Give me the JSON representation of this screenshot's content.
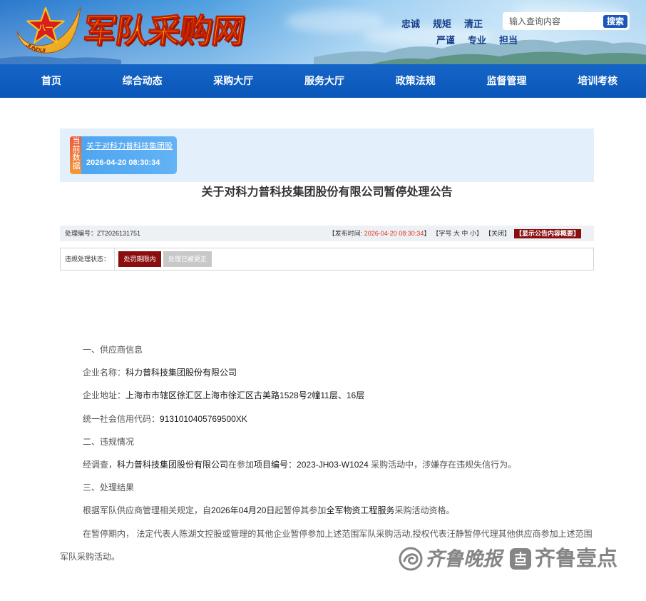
{
  "header": {
    "site_title": "军队采购网",
    "logo": {
      "emblem_mark": "八一",
      "swoosh_text": "JUNDUI",
      "icon": "army-emblem-icon"
    },
    "slogans_row1": [
      "忠诚",
      "规矩",
      "清正"
    ],
    "slogans_row2": [
      "严谨",
      "专业",
      "担当"
    ],
    "search": {
      "placeholder": "输入查询内容",
      "button_label": "搜索"
    }
  },
  "nav": {
    "items": [
      "首页",
      "综合动态",
      "采购大厅",
      "服务大厅",
      "政策法规",
      "监督管理",
      "培训考核"
    ]
  },
  "current_data": {
    "badge": "当前数据",
    "title": "关于对科力普科技集团股",
    "time": "2026-04-20 08:30:34"
  },
  "notice": {
    "title": "关于对科力普科技集团股份有限公司暂停处理公告",
    "info_bar": {
      "serial_label": "处理编号：",
      "serial_value": "ZT2026131751",
      "publish_prefix": "【发布时间: ",
      "publish_time": "2026-04-20 08:30:34",
      "publish_suffix": "】",
      "font_size_prefix": "【字号",
      "font_size_options": [
        "大",
        "中",
        "小"
      ],
      "font_size_suffix": "】",
      "close_label": "【关闭】",
      "summary_label": "【显示公告内容概要】"
    },
    "status": {
      "label": "违规处理状态：",
      "options": [
        {
          "label": "处罚期限内",
          "active": true
        },
        {
          "label": "处理已被更正",
          "active": false
        }
      ]
    },
    "body": {
      "section1_heading": "一、供应商信息",
      "company_name_label": "企业名称：",
      "company_name": "科力普科技集团股份有限公司",
      "address_label": "企业地址：",
      "address": "上海市市辖区徐汇区上海市徐汇区古美路1528号2幢11层、16层",
      "credit_code_label": "统一社会信用代码：",
      "credit_code": "9131010405769500XK",
      "section2_heading": "二、违规情况",
      "violation": [
        "经调查，",
        "科力普科技集团股份有限公司",
        "在参加",
        "项目编号：2023-JH03-W1024",
        " 采购活动中，涉嫌存在违规失信行为。"
      ],
      "section3_heading": "三、处理结果",
      "result": [
        "根据军队供应商管理相关规定，自",
        "2026年04月20日",
        "起暂停其参加",
        "全军物资工程服务",
        "采购活动资格。"
      ],
      "suspension_note": "在暂停期内， 法定代表人陈湖文控股或管理的其他企业暂停参加上述范围军队采购活动,授权代表汪静暂停代理其他供应商参加上述范围军队采购活动。"
    }
  },
  "watermark": {
    "left_brand": "齐鲁晚报",
    "right_brand": "齐鲁壹点",
    "left_icon": "qilu-evening-news-logo-icon",
    "right_icon": "qilu-yidian-logo-icon"
  },
  "colors": {
    "nav_bg": "#0a56b9",
    "search_blue": "#1a57b8",
    "panel_bg": "#e3effa",
    "card_blue": "#63b3f5",
    "badge_orange": "#f39a3b",
    "accent_red": "#8b0e0e",
    "date_red": "#e2341d",
    "slogan_blue": "#17408a",
    "title_orange": "#f8aa0a"
  }
}
